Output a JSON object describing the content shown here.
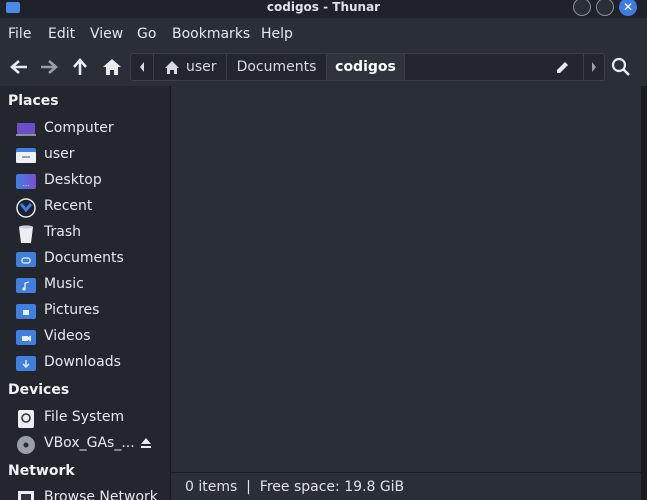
{
  "window": {
    "title": "codigos - Thunar"
  },
  "menu": [
    "File",
    "Edit",
    "View",
    "Go",
    "Bookmarks",
    "Help"
  ],
  "pathbar": {
    "segments": [
      "user",
      "Documents",
      "codigos"
    ]
  },
  "sidebar": {
    "places_header": "Places",
    "places": [
      {
        "label": "Computer",
        "icon": "computer-icon"
      },
      {
        "label": "user",
        "icon": "home-folder-icon"
      },
      {
        "label": "Desktop",
        "icon": "desktop-folder-icon"
      },
      {
        "label": "Recent",
        "icon": "recent-icon"
      },
      {
        "label": "Trash",
        "icon": "trash-icon"
      },
      {
        "label": "Documents",
        "icon": "documents-folder-icon"
      },
      {
        "label": "Music",
        "icon": "music-folder-icon"
      },
      {
        "label": "Pictures",
        "icon": "pictures-folder-icon"
      },
      {
        "label": "Videos",
        "icon": "videos-folder-icon"
      },
      {
        "label": "Downloads",
        "icon": "downloads-folder-icon"
      }
    ],
    "devices_header": "Devices",
    "devices": [
      {
        "label": "File System",
        "icon": "drive-icon"
      },
      {
        "label": "VBox_GAs_...",
        "icon": "optical-disc-icon"
      }
    ],
    "network_header": "Network",
    "network": [
      {
        "label": "Browse Network",
        "icon": "network-icon"
      }
    ]
  },
  "status": {
    "text": "0 items  |  Free space: 19.8 GiB"
  },
  "colors": {
    "accent": "#3f7fe0",
    "background": "#2a2e36",
    "sidebar": "#23262c"
  }
}
